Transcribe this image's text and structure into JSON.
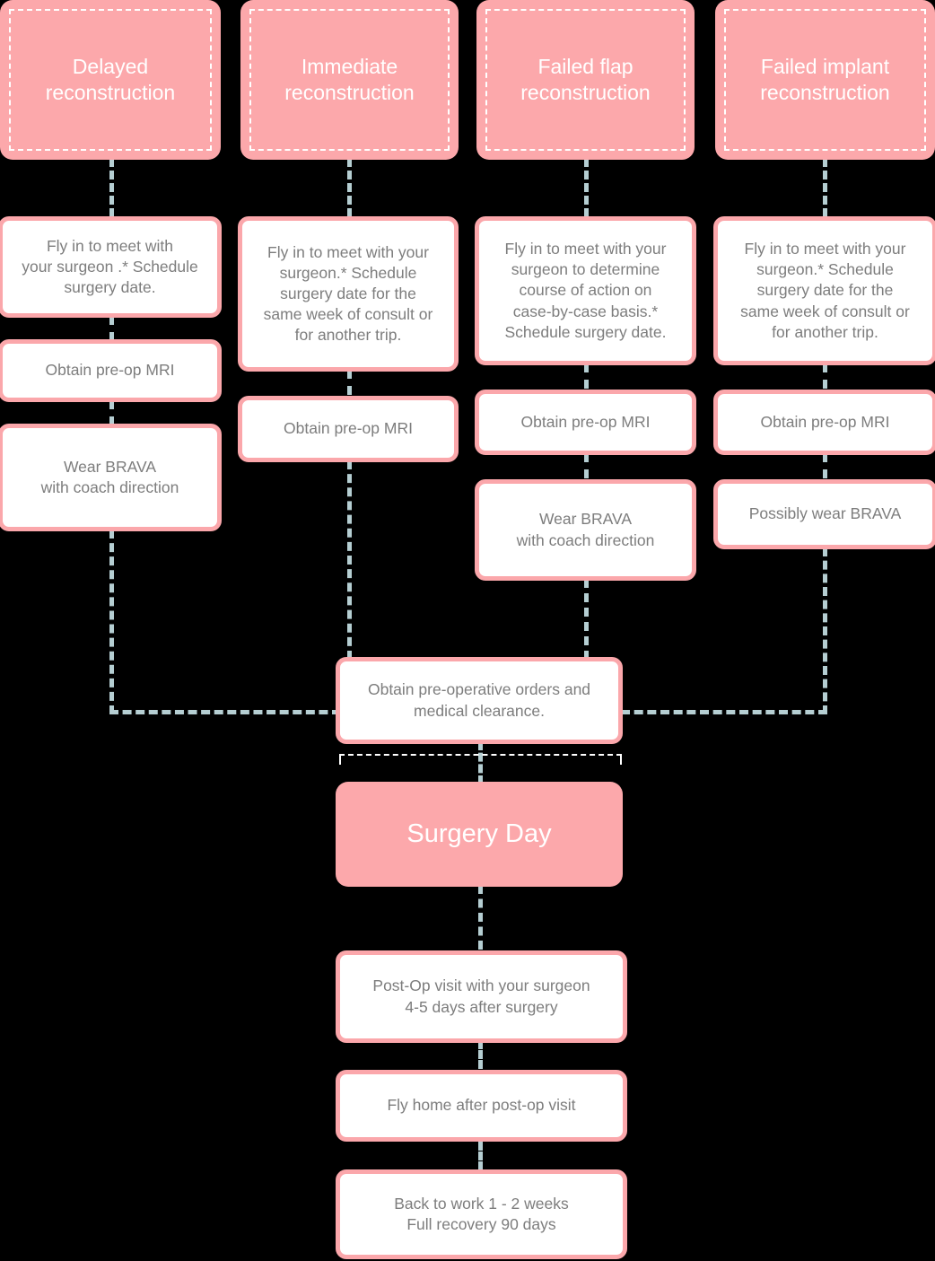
{
  "diagram": {
    "title": "Breast reconstruction surgery patient journey flowchart",
    "colors": {
      "background": "#000000",
      "accent_pink": "#fca8ab",
      "border_pink": "#fba7ab",
      "connector_blue": "#b5ced2",
      "body_text": "#7d7d7d",
      "header_text": "#ffffff"
    }
  },
  "columns": [
    {
      "id": "delayed",
      "header": "Delayed\nreconstruction",
      "steps": [
        "Fly in to meet with\nyour surgeon .* Schedule\nsurgery date.",
        "Obtain pre-op MRI",
        "Wear BRAVA\nwith coach direction"
      ]
    },
    {
      "id": "immediate",
      "header": "Immediate\nreconstruction",
      "steps": [
        "Fly in to meet with your\nsurgeon.*  Schedule\nsurgery date for the\nsame week of consult or\nfor another trip.",
        "Obtain pre-op MRI"
      ]
    },
    {
      "id": "failed-flap",
      "header": "Failed flap\nreconstruction",
      "steps": [
        "Fly in to meet with your\nsurgeon  to determine\ncourse of action on\ncase-by-case basis.*\nSchedule surgery date.",
        "Obtain pre-op MRI",
        "Wear BRAVA\nwith coach direction"
      ]
    },
    {
      "id": "failed-implant",
      "header": "Failed implant\nreconstruction",
      "steps": [
        "Fly in to meet with your\nsurgeon.* Schedule\nsurgery date for the\nsame week of consult or\nfor another trip.",
        "Obtain pre-op MRI",
        "Possibly wear BRAVA"
      ]
    }
  ],
  "shared": {
    "pre_op_orders": "Obtain pre-operative orders and\nmedical clearance.",
    "surgery_day": "Surgery Day",
    "post_op_visit": "Post-Op visit with your surgeon\n4-5 days after surgery",
    "fly_home": "Fly home after post-op visit",
    "recovery": "Back to work 1 - 2 weeks\nFull recovery 90 days"
  }
}
